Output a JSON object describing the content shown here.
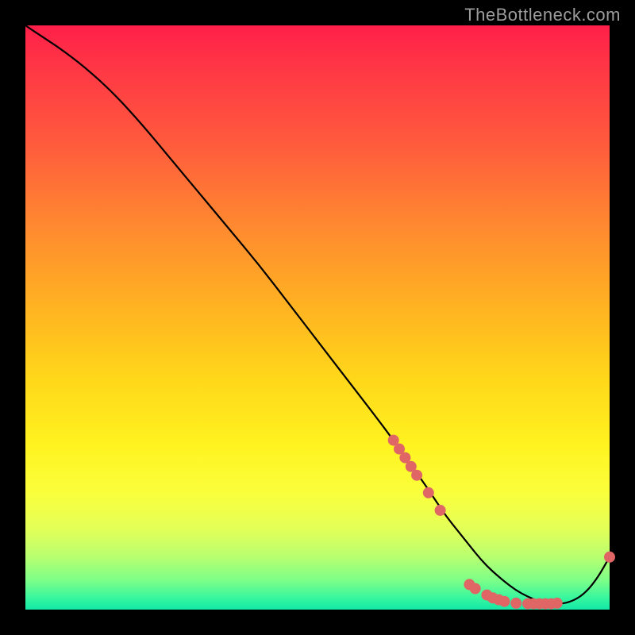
{
  "watermark": "TheBottleneck.com",
  "chart_data": {
    "type": "line",
    "title": "",
    "xlabel": "",
    "ylabel": "",
    "xlim": [
      0,
      100
    ],
    "ylim": [
      0,
      100
    ],
    "grid": false,
    "legend": false,
    "curve": {
      "name": "bottleneck-curve",
      "color": "#000000",
      "x": [
        0,
        3,
        6,
        10,
        15,
        20,
        25,
        30,
        35,
        40,
        45,
        50,
        55,
        60,
        63,
        65,
        68,
        70,
        72,
        74,
        76,
        78,
        80,
        82,
        84,
        86,
        88,
        90,
        92,
        94,
        96,
        98,
        100
      ],
      "y": [
        100,
        98,
        96,
        93,
        88.5,
        83,
        77,
        71,
        65,
        59,
        52.5,
        46,
        39.5,
        33,
        29,
        26,
        22,
        19,
        16,
        13.5,
        11,
        8.5,
        6.5,
        4.8,
        3.3,
        2.2,
        1.4,
        1.0,
        1.0,
        1.6,
        3.0,
        5.5,
        9.0
      ]
    },
    "markers": {
      "name": "highlight-dots",
      "color": "#e06666",
      "radius_px": 7,
      "points": [
        {
          "x": 63,
          "y": 29
        },
        {
          "x": 64,
          "y": 27.5
        },
        {
          "x": 65,
          "y": 26
        },
        {
          "x": 66,
          "y": 24.5
        },
        {
          "x": 67,
          "y": 23
        },
        {
          "x": 69,
          "y": 20
        },
        {
          "x": 71,
          "y": 17
        },
        {
          "x": 76,
          "y": 4.3
        },
        {
          "x": 77,
          "y": 3.6
        },
        {
          "x": 79,
          "y": 2.5
        },
        {
          "x": 80,
          "y": 2.0
        },
        {
          "x": 81,
          "y": 1.7
        },
        {
          "x": 82,
          "y": 1.4
        },
        {
          "x": 84,
          "y": 1.1
        },
        {
          "x": 86,
          "y": 1.0
        },
        {
          "x": 87,
          "y": 1.0
        },
        {
          "x": 88,
          "y": 1.0
        },
        {
          "x": 89,
          "y": 1.0
        },
        {
          "x": 90,
          "y": 1.0
        },
        {
          "x": 91,
          "y": 1.1
        },
        {
          "x": 100,
          "y": 9.0
        }
      ]
    }
  }
}
